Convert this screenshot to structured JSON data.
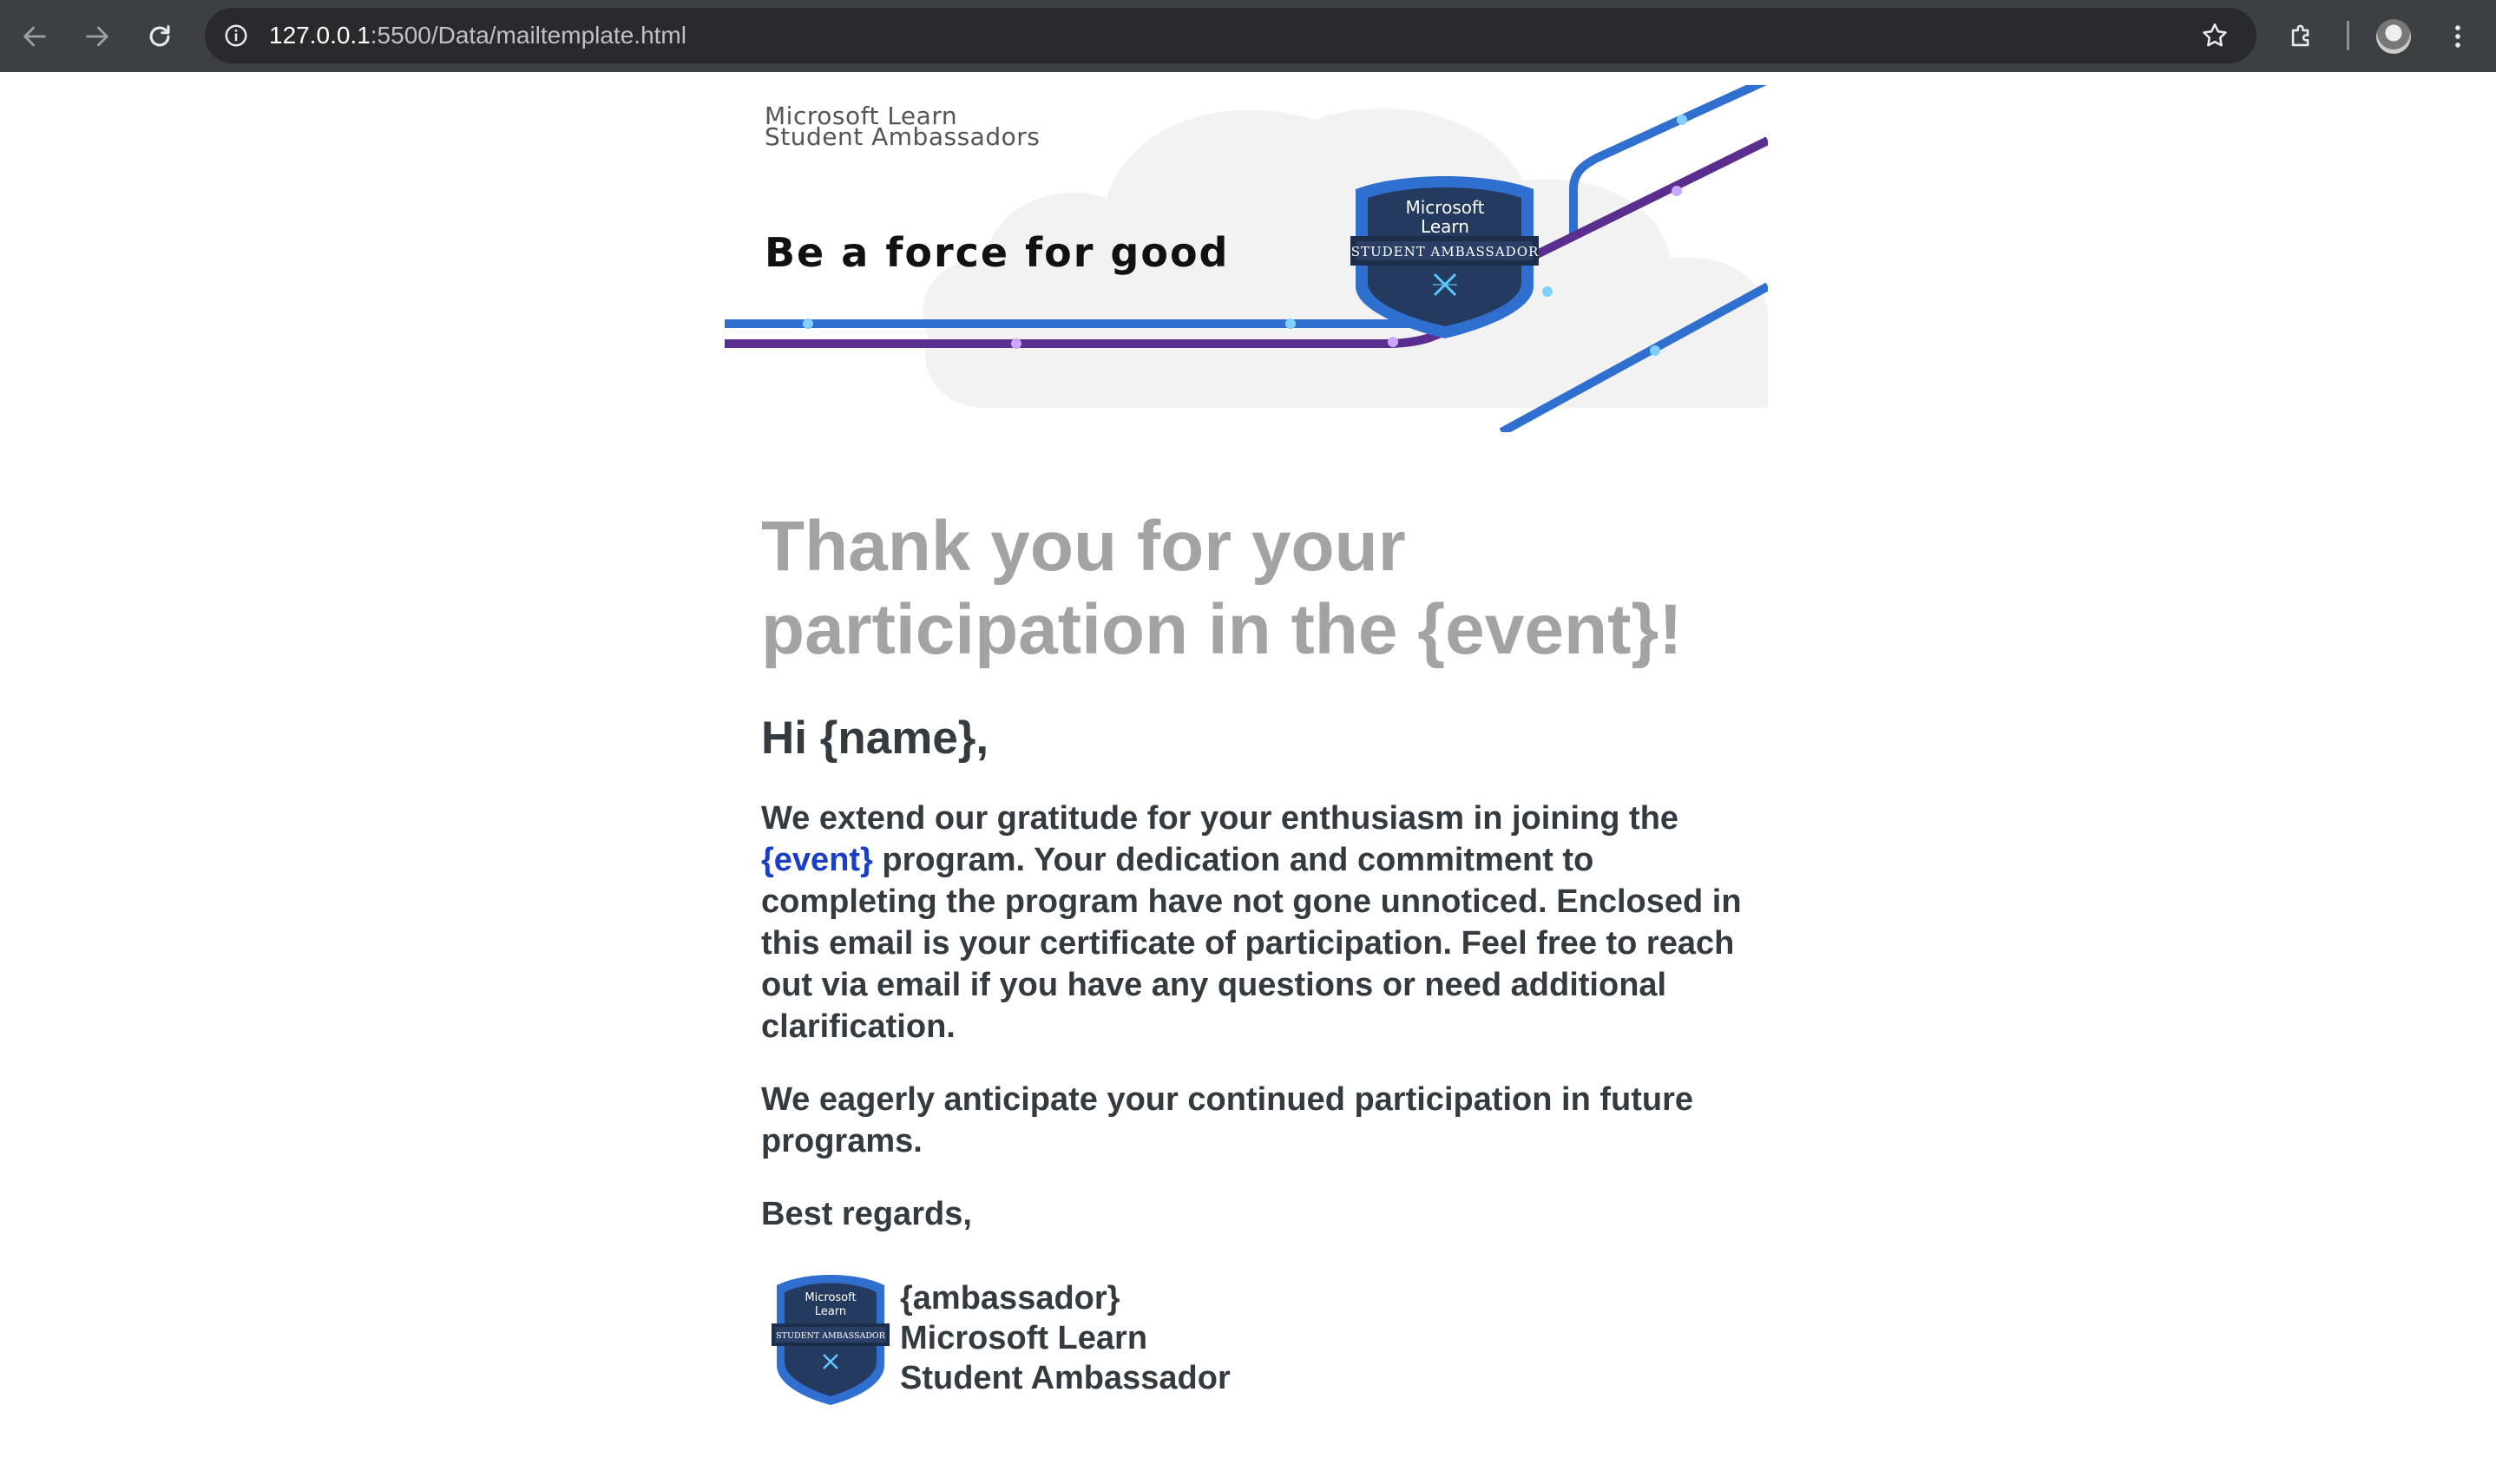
{
  "browser": {
    "url_host": "127.0.0.1",
    "url_path": ":5500/Data/mailtemplate.html"
  },
  "banner": {
    "brand_line1": "Microsoft Learn",
    "brand_line2": "Student Ambassadors",
    "tagline": "Be a force for good",
    "badge_top1": "Microsoft",
    "badge_top2": "Learn",
    "badge_ribbon": "STUDENT AMBASSADOR"
  },
  "email": {
    "headline_line1": "Thank you for your",
    "headline_line2": "participation in the {event}!",
    "greeting": "Hi {name},",
    "para1_before": "We extend our gratitude for your enthusiasm in joining the",
    "para1_link": "{event}",
    "para1_after": "program. Your dedication and commitment to completing the program have not gone unnoticed. Enclosed in this email is your certificate of participation. Feel free to reach out via email if you have any questions or need additional clarification.",
    "para2": "We eagerly anticipate your continued participation in future programs.",
    "regards": "Best regards,",
    "signature": {
      "name": "{ambassador}",
      "org": "Microsoft Learn",
      "role": "Student Ambassador",
      "badge_top1": "Microsoft",
      "badge_top2": "Learn",
      "badge_ribbon": "STUDENT AMBASSADOR"
    }
  },
  "colors": {
    "toolbar_bg": "#3c4043",
    "omnibox_bg": "#282a2d",
    "headline": "#a3a3a3",
    "body_text": "#333a40",
    "link": "#1a3fc4",
    "badge_blue": "#2f6fd0",
    "badge_navy": "#243a5e",
    "line_purple": "#5b2d8e"
  }
}
